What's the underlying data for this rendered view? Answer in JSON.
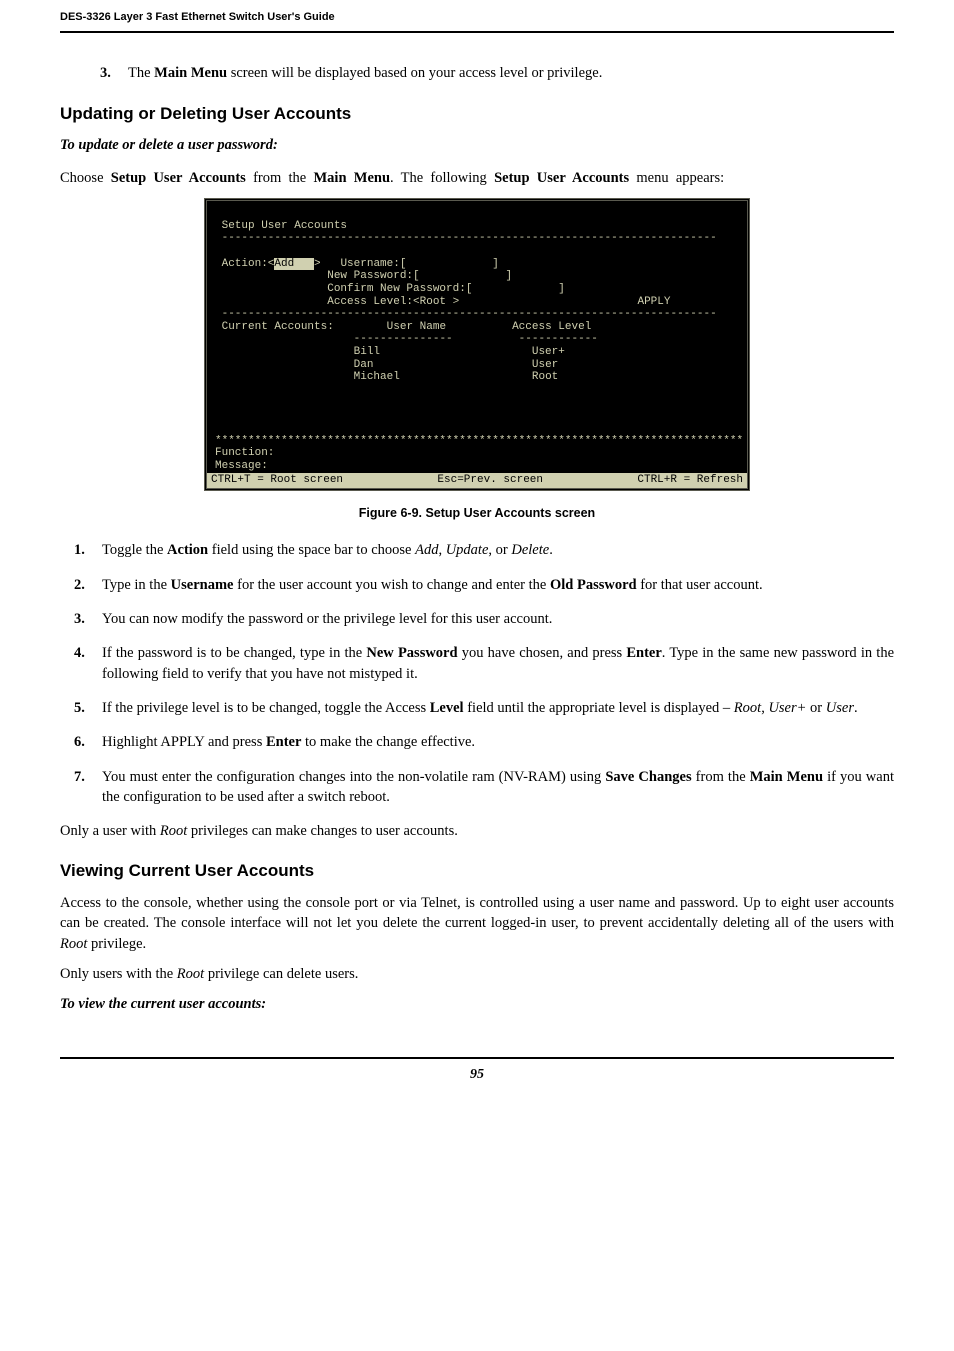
{
  "header": {
    "title": "DES-3326 Layer 3 Fast Ethernet Switch User's Guide"
  },
  "topItem": {
    "num": "3.",
    "pre": "The ",
    "b1": "Main Menu",
    "rest": " screen will be displayed based on your access level or privilege."
  },
  "h2_update": "Updating or Deleting User Accounts",
  "sub_update": "To update or delete a user password:",
  "intro_p": {
    "t1": "Choose ",
    "b1": "Setup User Accounts",
    "t2": " from the ",
    "b2": "Main Menu",
    "t3": ". The following ",
    "b3": "Setup User Accounts",
    "t4": " menu appears:"
  },
  "terminal": {
    "title": " Setup User Accounts",
    "rule": " ---------------------------------------------------------------------------",
    "action_label": " Action:<",
    "action_val": "Add   ",
    "action_close": ">   ",
    "f_user": "Username:[             ]",
    "f_newpw": "New Password:[             ]",
    "f_conf": "Confirm New Password:[             ]",
    "f_acc": "Access Level:<Root >",
    "apply": "APPLY",
    "col_hdr_left": " Current Accounts:",
    "col_hdr_user": "User Name",
    "col_hdr_acc": "Access Level",
    "col_rule_user": "---------------",
    "col_rule_acc": "------------",
    "rows": [
      {
        "user": "Bill",
        "acc": "User+"
      },
      {
        "user": "Dan",
        "acc": "User"
      },
      {
        "user": "Michael",
        "acc": "Root"
      }
    ],
    "stars": "********************************************************************************",
    "func": "Function:",
    "msg": "Message:",
    "status_left": "CTRL+T = Root screen",
    "status_mid": "Esc=Prev. screen",
    "status_right": "CTRL+R = Refresh"
  },
  "caption": "Figure 6-9.  Setup User Accounts screen",
  "steps": [
    {
      "num": "1.",
      "html": "Toggle the <b>Action</b> field using the space bar to choose <em>Add</em>, <em>Update</em>, or <em>Delete</em>."
    },
    {
      "num": "2.",
      "html": "Type in the <b>Username</b> for the user account you wish to change and enter the <b>Old Password</b> for that user account."
    },
    {
      "num": "3.",
      "html": "You can now modify the password or the privilege level for this user account."
    },
    {
      "num": "4.",
      "html": "If the password is to be changed, type in the <b>New Password</b> you have chosen, and press <b>Enter</b>. Type in the same new password in the following field to verify that you have not mistyped it."
    },
    {
      "num": "5.",
      "html": "If the privilege level is to be changed, toggle the Access <b>Level</b> field until the appropriate level is displayed – <em>Root</em>, <em>User+</em> or <em>User</em>."
    },
    {
      "num": "6.",
      "html": "Highlight APPLY and press <b>Enter</b> to make the change effective."
    },
    {
      "num": "7.",
      "html": "You must enter the configuration changes into the non-volatile ram (NV-RAM) using <b>Save Changes</b> from the <b>Main Menu</b> if you want the configuration to be used after a switch reboot."
    }
  ],
  "p_after_steps": "Only a user with <em>Root</em> privileges can make changes to user accounts.",
  "h2_view": "Viewing Current User Accounts",
  "p_view1": "Access to the console, whether using the console port or via Telnet, is controlled using a user name and password. Up to eight user accounts can be created. The console interface will not let you delete the current logged-in user, to prevent accidentally deleting all of the users with <em>Root</em> privilege.",
  "p_view2": "Only users with the <em>Root</em> privilege can delete users.",
  "sub_view": "To view the current user accounts",
  "footer": {
    "page": "95"
  }
}
